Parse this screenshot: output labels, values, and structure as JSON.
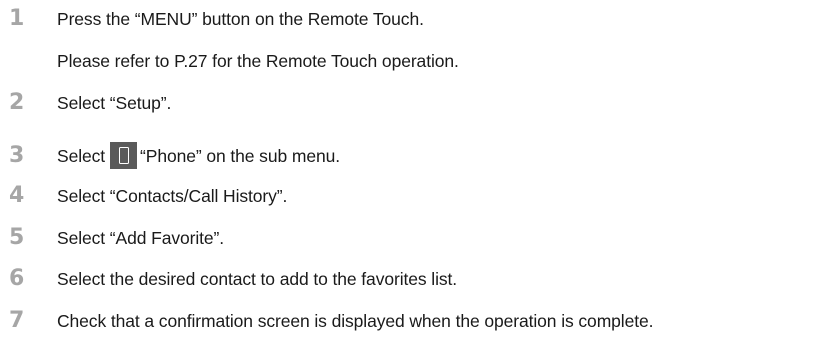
{
  "steps": [
    {
      "number": "1",
      "text": "Press the “MENU” button on the Remote Touch.",
      "subtext": "Please refer to P.27 for the Remote Touch operation."
    },
    {
      "number": "2",
      "text": "Select “Setup”."
    },
    {
      "number": "3",
      "text_before_icon": "Select",
      "icon": "phone-icon",
      "text_after_icon": "“Phone” on the sub menu."
    },
    {
      "number": "4",
      "text": "Select “Contacts/Call History”."
    },
    {
      "number": "5",
      "text": "Select “Add Favorite”."
    },
    {
      "number": "6",
      "text": "Select the desired contact to add to the favorites list."
    },
    {
      "number": "7",
      "text": "Check that a confirmation screen is displayed when the operation is complete."
    }
  ],
  "colors": {
    "step_number": "#a6a6a6",
    "body_text": "#1a1a1a",
    "icon_background": "#5a5a5a"
  }
}
